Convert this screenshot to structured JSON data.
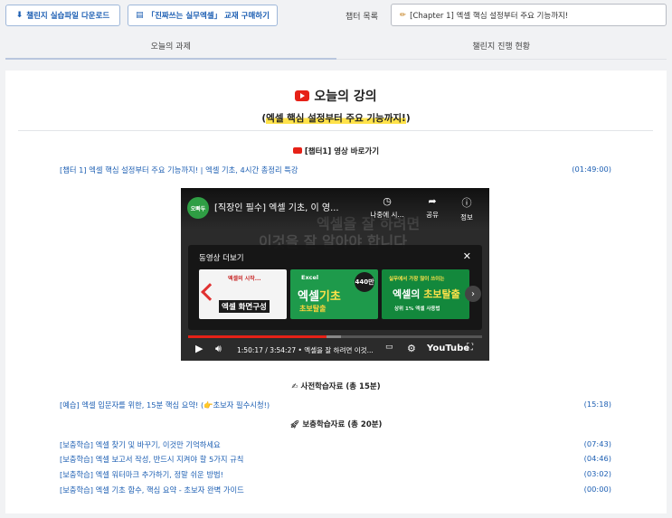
{
  "toolbar": {
    "download_label": "챌린지 실습파일 다운로드",
    "buy_label": "「진짜쓰는 실무엑셀」 교재 구매하기",
    "chapter_label": "챕터 목록",
    "chapter_selected": "[Chapter 1] 엑셀 핵심 설정부터 주요 기능까지!"
  },
  "tabs": [
    {
      "label": "오늘의 과제"
    },
    {
      "label": "챌린지 진행 현황"
    }
  ],
  "lecture": {
    "title": "오늘의 강의",
    "subtitle": "엑셀 핵심 설정부터 주요 기능까지!"
  },
  "video_section": {
    "heading": "[챕터1] 영상 바로가기",
    "link_text": "[챕터 1] 엑셀 핵심 설정부터 주요 기능까지! | 엑셀 기초, 4시간 총정리 특강",
    "duration": "(01:49:00)"
  },
  "player": {
    "channel": "오빠두",
    "title": "[직장인 필수] 엑셀 기초, 이 영...",
    "bg_text_line1": "엑셀을 잘 하려면",
    "bg_text_line2": "이것을 잘 알아야 합니다",
    "watch_later": "나중에 시...",
    "share": "공유",
    "info": "정보",
    "more_videos": "동영상 더보기",
    "time": "1:50:17 / 3:54:27 • 엑셀을 잘 하려면 이것...",
    "youtube": "YouTube",
    "progress_fraction": 0.47,
    "loaded_fraction": 0.52,
    "thumbs": [
      {
        "subtitle": "엑셀의 시작...",
        "title": "엑셀 화면구성"
      },
      {
        "label": "Excel",
        "title_a": "엑셀",
        "title_b": "기초",
        "badge": "440만",
        "sub": "초보탈출"
      },
      {
        "top": "실무에서 가장 많이 쓰이는",
        "title_a": "엑셀의 ",
        "title_b": "초보탈출",
        "bot": "상위 1% 엑셀 사용법"
      }
    ]
  },
  "prestudy": {
    "heading": "사전학습자료 (총 15분)",
    "items": [
      {
        "title": "[예습] 엑셀 입문자를 위한, 15분 핵심 요약! (👉초보자 필수시청!)",
        "duration": "(15:18)"
      }
    ]
  },
  "supplement": {
    "heading": "보충학습자료 (총 20분)",
    "items": [
      {
        "title": "[보충학습] 엑셀 찾기 및 바꾸기, 이것만 기억하세요",
        "duration": "(07:43)"
      },
      {
        "title": "[보충학습] 엑셀 보고서 작성, 반드시 지켜야 할 5가지 규칙",
        "duration": "(04:46)"
      },
      {
        "title": "[보충학습] 엑셀 워터마크 추가하기, 정말 쉬운 방법!",
        "duration": "(03:02)"
      },
      {
        "title": "[보충학습] 엑셀 기초 함수, 핵심 요약 - 초보자 완벽 가이드",
        "duration": "(00:00)"
      }
    ]
  },
  "colors": {
    "accent_blue": "#1d5fb3",
    "youtube_red": "#e62117",
    "highlight_yellow": "#ffe24a"
  }
}
